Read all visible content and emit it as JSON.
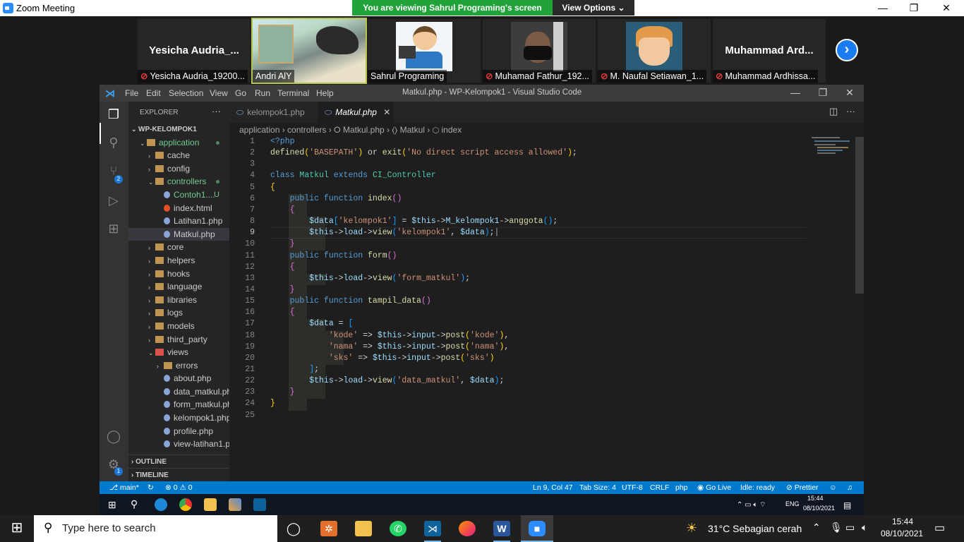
{
  "zoom": {
    "window_title": "Zoom Meeting",
    "banner_text": "You are viewing Sahrul Programing's screen",
    "view_options_label": "View Options ⌄",
    "minimize": "—",
    "restore": "❐",
    "close": "✕",
    "participants": [
      {
        "big_name": "Yesicha  Audria_...",
        "label": "Yesicha Audria_19200...",
        "muted": true
      },
      {
        "big_name": "",
        "label": "Andri AlY",
        "muted": false
      },
      {
        "big_name": "",
        "label": "Sahrul Programing",
        "muted": false
      },
      {
        "big_name": "",
        "label": "Muhamad Fathur_192...",
        "muted": true
      },
      {
        "big_name": "",
        "label": "M. Naufal Setiawan_1...",
        "muted": true
      },
      {
        "big_name": "Muhammad  Ard...",
        "label": "Muhammad Ardhissa...",
        "muted": true
      }
    ],
    "next_page_arrow": "›"
  },
  "vscode": {
    "menu": [
      "File",
      "Edit",
      "Selection",
      "View",
      "Go",
      "Run",
      "Terminal",
      "Help"
    ],
    "window_title": "Matkul.php - WP-Kelompok1 - Visual Studio Code",
    "explorer_header": "EXPLORER",
    "explorer_more": "···",
    "scm_badge": "2",
    "settings_badge": "1",
    "root_folder": "WP-KELOMPOK1",
    "tree": [
      {
        "label": "application",
        "kind": "folder-open",
        "indent": 1,
        "green": true,
        "dot": true
      },
      {
        "label": "cache",
        "kind": "folder",
        "indent": 2
      },
      {
        "label": "config",
        "kind": "folder",
        "indent": 2
      },
      {
        "label": "controllers",
        "kind": "folder-open",
        "indent": 2,
        "green": true,
        "dot": true
      },
      {
        "label": "Contoh1....",
        "kind": "php",
        "indent": 3,
        "green": true,
        "u": "U"
      },
      {
        "label": "index.html",
        "kind": "html",
        "indent": 3
      },
      {
        "label": "Latihan1.php",
        "kind": "php",
        "indent": 3
      },
      {
        "label": "Matkul.php",
        "kind": "php",
        "indent": 3,
        "selected": true
      },
      {
        "label": "core",
        "kind": "folder",
        "indent": 2
      },
      {
        "label": "helpers",
        "kind": "folder",
        "indent": 2
      },
      {
        "label": "hooks",
        "kind": "folder",
        "indent": 2
      },
      {
        "label": "language",
        "kind": "folder",
        "indent": 2
      },
      {
        "label": "libraries",
        "kind": "folder",
        "indent": 2
      },
      {
        "label": "logs",
        "kind": "folder",
        "indent": 2
      },
      {
        "label": "models",
        "kind": "folder",
        "indent": 2
      },
      {
        "label": "third_party",
        "kind": "folder",
        "indent": 2
      },
      {
        "label": "views",
        "kind": "folder-open-red",
        "indent": 2
      },
      {
        "label": "errors",
        "kind": "folder",
        "indent": 3
      },
      {
        "label": "about.php",
        "kind": "php",
        "indent": 3
      },
      {
        "label": "data_matkul.php",
        "kind": "php",
        "indent": 3
      },
      {
        "label": "form_matkul.php",
        "kind": "php",
        "indent": 3
      },
      {
        "label": "kelompok1.php",
        "kind": "php",
        "indent": 3
      },
      {
        "label": "profile.php",
        "kind": "php",
        "indent": 3
      },
      {
        "label": "view-latihan1.p...",
        "kind": "php",
        "indent": 3
      }
    ],
    "outline_label": "OUTLINE",
    "timeline_label": "TIMELINE",
    "tabs": [
      {
        "label": "kelompok1.php",
        "active": false
      },
      {
        "label": "Matkul.php",
        "active": true,
        "close": "✕"
      }
    ],
    "breadcrumb": "application › controllers › ⭘ Matkul.php › ⟨⟩ Matkul › ⬡ index",
    "current_line": 9,
    "status": {
      "branch": "⎇ main*",
      "sync": "↻",
      "problems": "⊗ 0 ⚠ 0",
      "position": "Ln 9, Col 47",
      "tab_size": "Tab Size: 4",
      "encoding": "UTF-8",
      "eol": "CRLF",
      "language": "php",
      "go_live": "◉ Go Live",
      "idle": "Idle: ready",
      "prettier": "⊘ Prettier"
    }
  },
  "inner_taskbar": {
    "time": "15:44",
    "date": "08/10/2021",
    "lang": "ENG"
  },
  "taskbar": {
    "search_placeholder": "Type here to search",
    "weather": "31°C  Sebagian cerah",
    "time": "15:44",
    "date": "08/10/2021"
  }
}
